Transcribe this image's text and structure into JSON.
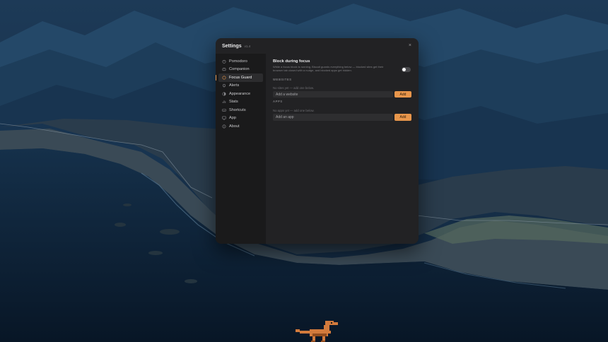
{
  "window": {
    "title": "Settings",
    "version": "v1.4",
    "close_glyph": "×"
  },
  "sidebar": {
    "items": [
      {
        "label": "Pomodoro",
        "icon": "timer-icon"
      },
      {
        "label": "Companion",
        "icon": "companion-icon"
      },
      {
        "label": "Focus Guard",
        "icon": "shield-icon",
        "active": true
      },
      {
        "label": "Alerts",
        "icon": "bell-icon"
      },
      {
        "label": "Appearance",
        "icon": "appearance-icon"
      },
      {
        "label": "Stats",
        "icon": "stats-icon"
      },
      {
        "label": "Shortcuts",
        "icon": "keyboard-icon"
      },
      {
        "label": "App",
        "icon": "monitor-icon"
      },
      {
        "label": "About",
        "icon": "info-icon"
      }
    ]
  },
  "focus_guard": {
    "block_title": "Block during focus",
    "block_description": "While a focus block is running, Biscuit guards everything below — blocked sites get their browser tab closed with a nudge, and blocked apps get hidden.",
    "toggle_on": false,
    "websites": {
      "label": "WEBSITES",
      "empty": "No sites yet — add one below.",
      "placeholder": "Add a website",
      "add_label": "Add"
    },
    "apps": {
      "label": "APPS",
      "empty": "No apps yet — add one below.",
      "placeholder": "Add an app",
      "add_label": "Add"
    }
  },
  "colors": {
    "accent": "#e8964b",
    "window_bg": "#222224",
    "sidebar_bg": "#1a1a1b"
  }
}
